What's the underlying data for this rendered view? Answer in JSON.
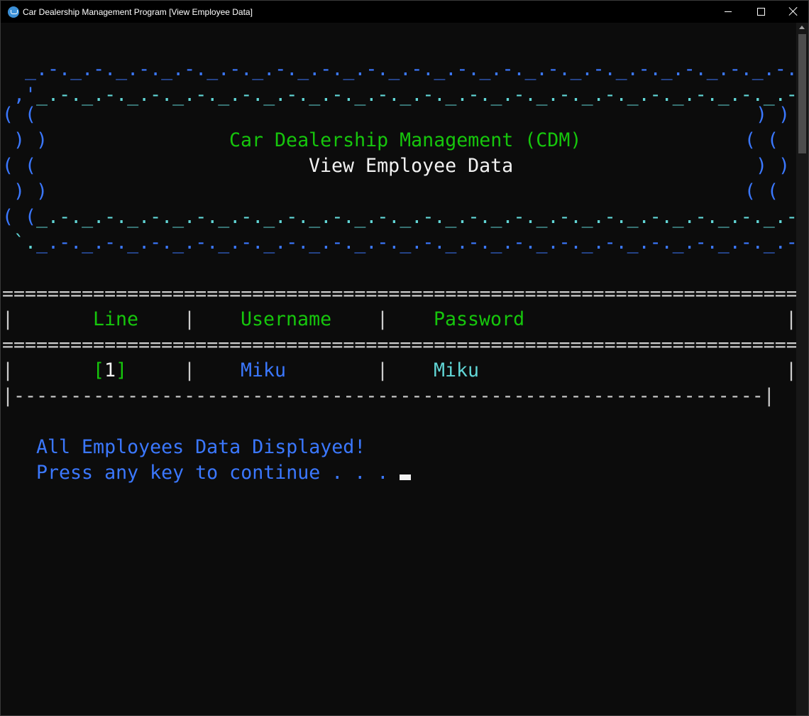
{
  "window": {
    "title": "Car Dealership Management Program [View Employee Data]",
    "icon": "app-icon",
    "controls": {
      "minimize": "minimize-icon",
      "maximize": "maximize-icon",
      "close": "close-icon"
    }
  },
  "banner": {
    "row1": "  _.-._.-._.-._.-._.-._.-._.-._.-._.-._.-._.-._.-._.-._.-._.-._.-._.-._",
    "row2a": " ,'",
    "row2b": "_.-._.-._.-._.-._.-._.-._.-._.-._.-._.-._.-._.-._.-._.-._.-._.-._.-._.-.",
    "row2c": "`.",
    "title": "Car Dealership Management (CDM)",
    "subtitle": "View Employee Data",
    "row7a": "( (",
    "row7b": "_.-._.-._.-._.-._.-._.-._.-._.-._.-._.-._.-._.-._.-._.-._.-._.-._.-._.-._",
    "row7c": ") )",
    "row8a": " `.",
    "row8b": "_.-._.-._.-._.-._.-._.-._.-._.-._.-._.-._.-._.-._.-._.-._.-._.-._.-._.-._.",
    "row8c": "'",
    "paren_left_a": "( (",
    "paren_left_b": " ) )",
    "paren_right_a": ") )",
    "paren_right_b": "( ("
  },
  "table": {
    "double_rule": "======================================================================",
    "single_rule": "|------------------------------------------------------------------|",
    "pipe": "|",
    "headers": {
      "line": "Line",
      "username": "Username",
      "password": "Password"
    },
    "rows": [
      {
        "bracket_open": "[",
        "line": "1",
        "bracket_close": "]",
        "username": "Miku",
        "password": "Miku"
      }
    ]
  },
  "messages": {
    "done": "All Employees Data Displayed!",
    "prompt": "Press any key to continue . . ."
  },
  "colors": {
    "background": "#0c0c0c",
    "green": "#16c60c",
    "blue": "#3b78ff",
    "cyan": "#61d6d6",
    "white": "#f2f2f2"
  }
}
